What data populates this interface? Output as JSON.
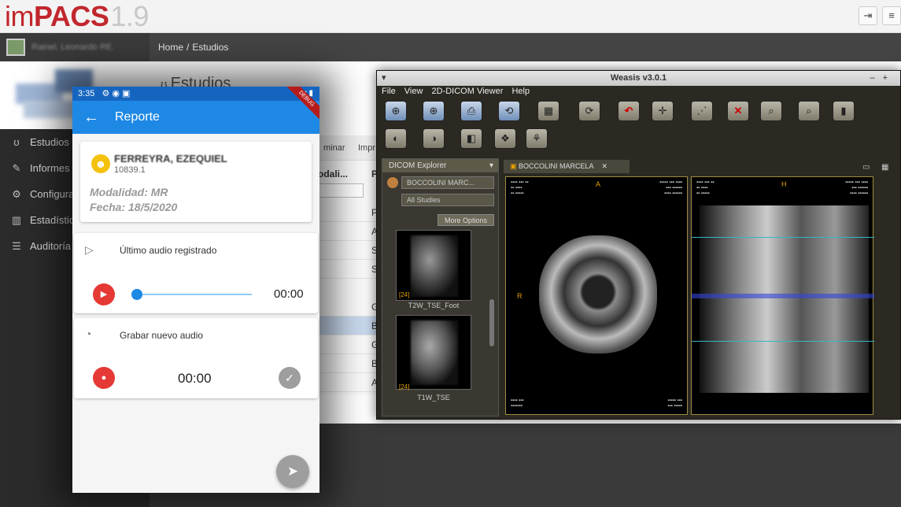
{
  "app": {
    "brand_prefix": "im",
    "brand_name": "PACS",
    "brand_version": "1.9"
  },
  "header": {
    "user_name": "Rainel, Leonardo RE.",
    "breadcrumb": [
      "Home",
      "/",
      "Estudios"
    ]
  },
  "sidebar": {
    "items": [
      {
        "label": "Estudios",
        "icon": "stethoscope-icon"
      },
      {
        "label": "Informes",
        "icon": "edit-icon"
      },
      {
        "label": "Configura",
        "icon": "gear-icon"
      },
      {
        "label": "Estadístic",
        "icon": "bar-chart-icon"
      },
      {
        "label": "Auditoría",
        "icon": "list-icon"
      }
    ]
  },
  "page": {
    "title": "Estudios",
    "tabs": [
      "minar",
      "Impr"
    ],
    "column_header": "odali...",
    "column_p": "P",
    "rows": [
      "P",
      "A",
      "S",
      "S",
      "G",
      "B",
      "G",
      "B",
      "A"
    ]
  },
  "phone": {
    "status_time": "3:35",
    "debug_label": "DEBUG",
    "appbar_title": "Reporte",
    "patient_name": "FERREYRA, EZEQUIEL",
    "patient_id": "10839.1",
    "modality": "Modalidad: MR",
    "date": "Fecha: 18/5/2020",
    "last_audio_label": "Último audio registrado",
    "player_time": "00:00",
    "record_label": "Grabar nuevo audio",
    "record_time": "00:00",
    "player_progress": 0
  },
  "weasis": {
    "window_title": "Weasis v3.0.1",
    "menu": [
      "File",
      "View",
      "2D-DICOM Viewer",
      "Help"
    ],
    "explorer_title": "DICOM Explorer",
    "patient_select": "BOCCOLINI MARC...",
    "studies_select": "All Studies",
    "more_options": "More Options",
    "viewer_tab": "BOCCOLINI MARCELA",
    "series": [
      {
        "label": "T2W_TSE_Foot",
        "count": "[24]"
      },
      {
        "label": "T1W_TSE",
        "count": "[24]"
      }
    ],
    "orientation_left": [
      "A",
      "R"
    ],
    "orientation_right": [
      "H"
    ]
  }
}
